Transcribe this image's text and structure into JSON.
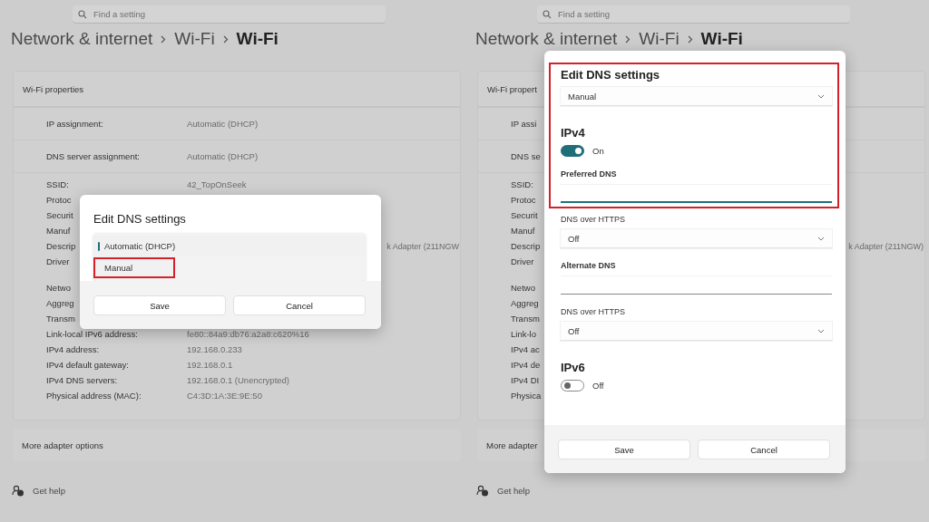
{
  "panels": [
    {
      "search": {
        "placeholder": "Find a setting"
      },
      "breadcrumb": [
        "Network & internet",
        "Wi-Fi",
        "Wi-Fi"
      ],
      "properties_header": "Wi-Fi properties",
      "settings": [
        {
          "label": "IP assignment:",
          "value": "Automatic (DHCP)"
        },
        {
          "label": "DNS server assignment:",
          "value": "Automatic (DHCP)"
        }
      ],
      "detail_groups": [
        [
          {
            "label": "SSID:",
            "value": "42_TopOnSeek"
          },
          {
            "label": "Protoc"
          },
          {
            "label": "Securit"
          },
          {
            "label": "Manuf"
          },
          {
            "label": "Descrip",
            "partial_value": "k Adapter (211NGW"
          },
          {
            "label": "Driver"
          }
        ],
        [
          {
            "label": "Netwo"
          },
          {
            "label": "Aggreg"
          },
          {
            "label": "Transm"
          },
          {
            "label": "Link-local IPv6 address:",
            "value": "fe80::84a9:db76:a2a8:c620%16"
          },
          {
            "label": "IPv4 address:",
            "value": "192.168.0.233"
          },
          {
            "label": "IPv4 default gateway:",
            "value": "192.168.0.1"
          },
          {
            "label": "IPv4 DNS servers:",
            "value": "192.168.0.1 (Unencrypted)"
          },
          {
            "label": "Physical address (MAC):",
            "value": "C4:3D:1A:3E:9E:50"
          }
        ]
      ],
      "more": "More adapter options",
      "help": "Get help",
      "dialog": {
        "kind": "picker",
        "title": "Edit DNS settings",
        "options": [
          {
            "label": "Automatic (DHCP)",
            "selected": true,
            "highlighted": false
          },
          {
            "label": "Manual",
            "selected": false,
            "highlighted": true
          }
        ],
        "buttons": [
          "Save",
          "Cancel"
        ]
      }
    },
    {
      "search": {
        "placeholder": "Find a setting"
      },
      "breadcrumb": [
        "Network & internet",
        "Wi-Fi",
        "Wi-Fi"
      ],
      "properties_header": "Wi-Fi propert",
      "settings": [
        {
          "label": "IP assi"
        },
        {
          "label": "DNS se"
        }
      ],
      "detail_groups": [
        [
          {
            "label": "SSID:"
          },
          {
            "label": "Protoc"
          },
          {
            "label": "Securit"
          },
          {
            "label": "Manuf"
          },
          {
            "label": "Descrip",
            "partial_value": "k Adapter (211NGW)"
          },
          {
            "label": "Driver"
          }
        ],
        [
          {
            "label": "Netwo"
          },
          {
            "label": "Aggreg"
          },
          {
            "label": "Transm"
          },
          {
            "label": "Link-lo"
          },
          {
            "label": "IPv4 ac"
          },
          {
            "label": "IPv4 de"
          },
          {
            "label": "IPv4 DI"
          },
          {
            "label": "Physica"
          }
        ]
      ],
      "more": "More adapter",
      "help": "Get help",
      "dialog": {
        "kind": "form",
        "groups": [
          {
            "highlighted": true,
            "items": [
              {
                "kind": "title",
                "text": "Edit DNS settings"
              },
              {
                "kind": "select",
                "value": "Manual"
              },
              {
                "kind": "heading",
                "text": "IPv4"
              },
              {
                "kind": "toggle",
                "on": true,
                "text": "On"
              },
              {
                "kind": "label",
                "text": "Preferred DNS",
                "strong": true
              },
              {
                "kind": "input",
                "focused": true
              }
            ]
          },
          {
            "highlighted": false,
            "items": [
              {
                "kind": "label",
                "text": "DNS over HTTPS",
                "strong": false
              },
              {
                "kind": "select",
                "value": "Off"
              },
              {
                "kind": "label",
                "text": "Alternate DNS",
                "strong": true
              },
              {
                "kind": "input",
                "focused": false
              },
              {
                "kind": "label",
                "text": "DNS over HTTPS",
                "strong": false
              },
              {
                "kind": "select",
                "value": "Off"
              },
              {
                "kind": "heading",
                "text": "IPv6"
              },
              {
                "kind": "toggle",
                "on": false,
                "text": "Off"
              }
            ]
          }
        ],
        "buttons": [
          "Save",
          "Cancel"
        ]
      }
    }
  ]
}
